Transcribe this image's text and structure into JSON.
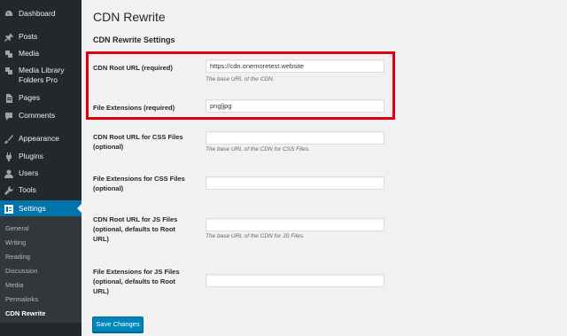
{
  "sidebar": {
    "items": [
      {
        "label": "Dashboard",
        "icon": "dashboard-icon"
      },
      {
        "label": "Posts",
        "icon": "pin-icon"
      },
      {
        "label": "Media",
        "icon": "media-icon"
      },
      {
        "label": "Media Library Folders Pro",
        "icon": "media-folder-icon"
      },
      {
        "label": "Pages",
        "icon": "page-icon"
      },
      {
        "label": "Comments",
        "icon": "comment-icon"
      },
      {
        "label": "Appearance",
        "icon": "brush-icon"
      },
      {
        "label": "Plugins",
        "icon": "plugin-icon"
      },
      {
        "label": "Users",
        "icon": "user-icon"
      },
      {
        "label": "Tools",
        "icon": "wrench-icon"
      },
      {
        "label": "Settings",
        "icon": "settings-icon",
        "active": true
      }
    ],
    "submenu": [
      "General",
      "Writing",
      "Reading",
      "Discussion",
      "Media",
      "Permalinks",
      "CDN Rewrite"
    ],
    "current_submenu": "CDN Rewrite"
  },
  "page": {
    "title": "CDN Rewrite",
    "section_title": "CDN Rewrite Settings"
  },
  "fields": [
    {
      "label": "CDN Root URL (required)",
      "value": "https://cdn.onemoretest.website",
      "description": "The base URL of the CDN."
    },
    {
      "label": "File Extensions (required)",
      "value": "png|jpg",
      "description": ""
    },
    {
      "label": "CDN Root URL for CSS Files (optional)",
      "value": "",
      "description": "The base URL of the CDN for CSS Files."
    },
    {
      "label": "File Extensions for CSS Files (optional)",
      "value": "",
      "description": ""
    },
    {
      "label": "CDN Root URL for JS Files (optional, defaults to Root URL)",
      "value": "",
      "description": "The base URL of the CDN for JS Files."
    },
    {
      "label": "File Extensions for JS Files (optional, defaults to Root URL)",
      "value": "",
      "description": ""
    }
  ],
  "save_label": "Save Changes",
  "colors": {
    "sidebar_bg": "#23282d",
    "active_menu": "#0073aa",
    "primary_button": "#0085ba",
    "highlight_border": "#e0000f"
  }
}
